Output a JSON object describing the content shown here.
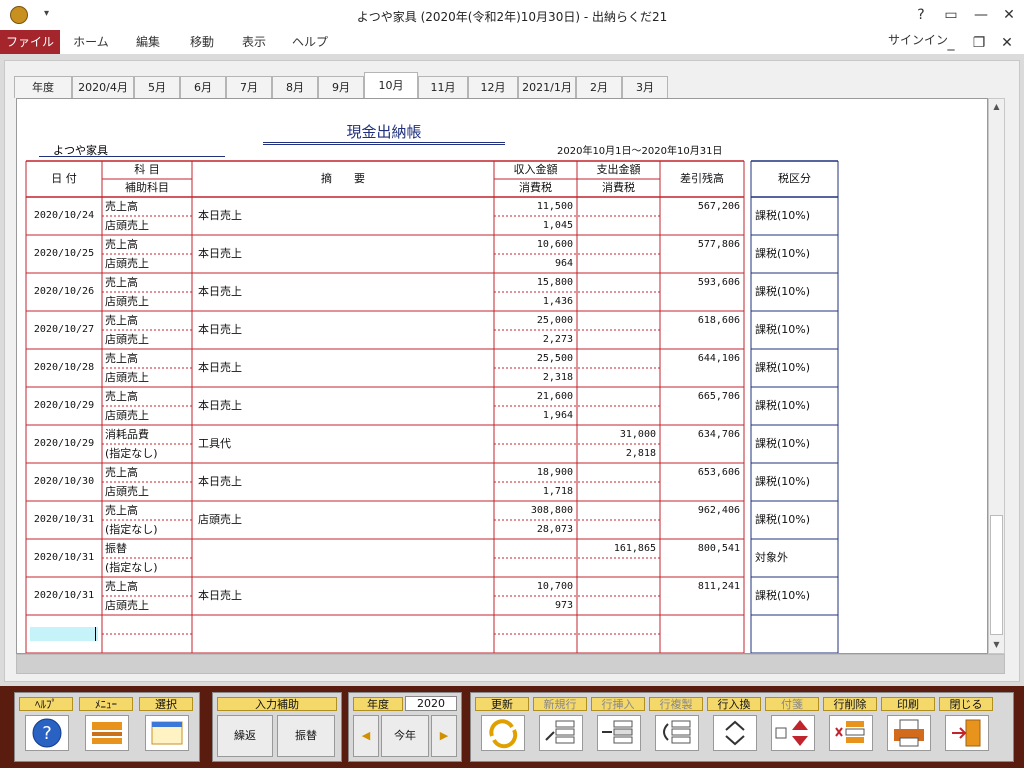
{
  "window": {
    "title": "よつや家具 (2020年(令和2年)10月30日) - 出納らくだ21",
    "qat": "▾",
    "help": "?",
    "restore": "▭",
    "minimize": "—",
    "close": "✕"
  },
  "menu": {
    "file": "ファイル",
    "items": [
      "ホーム",
      "編集",
      "移動",
      "表示",
      "ヘルプ"
    ],
    "signin": "サインイン",
    "min": "_",
    "restore": "❐",
    "close": "✕"
  },
  "tabs": [
    "年度",
    "2020/4月",
    "5月",
    "6月",
    "7月",
    "8月",
    "9月",
    "10月",
    "11月",
    "12月",
    "2021/1月",
    "2月",
    "3月"
  ],
  "active_tab": "10月",
  "ledger": {
    "company": "よつや家具",
    "title": "現金出納帳",
    "period": "2020年10月1日～2020年10月31日",
    "headers": {
      "date": "日 付",
      "account": "科 目",
      "sub_account": "補助科目",
      "summary": "摘　　要",
      "income": "収入金額",
      "income_tax": "消費税",
      "expense": "支出金額",
      "expense_tax": "消費税",
      "balance": "差引残高",
      "tax_class": "税区分"
    },
    "rows": [
      {
        "date": "2020/10/24",
        "account": "売上高",
        "sub": "店頭売上",
        "summary": "本日売上",
        "income": "11,500",
        "income_tax": "1,045",
        "expense": "",
        "expense_tax": "",
        "balance": "567,206",
        "tax": "課税(10%)"
      },
      {
        "date": "2020/10/25",
        "account": "売上高",
        "sub": "店頭売上",
        "summary": "本日売上",
        "income": "10,600",
        "income_tax": "964",
        "expense": "",
        "expense_tax": "",
        "balance": "577,806",
        "tax": "課税(10%)"
      },
      {
        "date": "2020/10/26",
        "account": "売上高",
        "sub": "店頭売上",
        "summary": "本日売上",
        "income": "15,800",
        "income_tax": "1,436",
        "expense": "",
        "expense_tax": "",
        "balance": "593,606",
        "tax": "課税(10%)"
      },
      {
        "date": "2020/10/27",
        "account": "売上高",
        "sub": "店頭売上",
        "summary": "本日売上",
        "income": "25,000",
        "income_tax": "2,273",
        "expense": "",
        "expense_tax": "",
        "balance": "618,606",
        "tax": "課税(10%)"
      },
      {
        "date": "2020/10/28",
        "account": "売上高",
        "sub": "店頭売上",
        "summary": "本日売上",
        "income": "25,500",
        "income_tax": "2,318",
        "expense": "",
        "expense_tax": "",
        "balance": "644,106",
        "tax": "課税(10%)"
      },
      {
        "date": "2020/10/29",
        "account": "売上高",
        "sub": "店頭売上",
        "summary": "本日売上",
        "income": "21,600",
        "income_tax": "1,964",
        "expense": "",
        "expense_tax": "",
        "balance": "665,706",
        "tax": "課税(10%)"
      },
      {
        "date": "2020/10/29",
        "account": "消耗品費",
        "sub": "(指定なし)",
        "summary": "工具代",
        "income": "",
        "income_tax": "",
        "expense": "31,000",
        "expense_tax": "2,818",
        "balance": "634,706",
        "tax": "課税(10%)"
      },
      {
        "date": "2020/10/30",
        "account": "売上高",
        "sub": "店頭売上",
        "summary": "本日売上",
        "income": "18,900",
        "income_tax": "1,718",
        "expense": "",
        "expense_tax": "",
        "balance": "653,606",
        "tax": "課税(10%)"
      },
      {
        "date": "2020/10/31",
        "account": "売上高",
        "sub": "(指定なし)",
        "summary": "店頭売上",
        "income": "308,800",
        "income_tax": "28,073",
        "expense": "",
        "expense_tax": "",
        "balance": "962,406",
        "tax": "課税(10%)"
      },
      {
        "date": "2020/10/31",
        "account": "振替",
        "sub": "(指定なし)",
        "summary": "",
        "income": "",
        "income_tax": "",
        "expense": "161,865",
        "expense_tax": "",
        "balance": "800,541",
        "tax": "対象外"
      },
      {
        "date": "2020/10/31",
        "account": "売上高",
        "sub": "店頭売上",
        "summary": "本日売上",
        "income": "10,700",
        "income_tax": "973",
        "expense": "",
        "expense_tax": "",
        "balance": "811,241",
        "tax": "課税(10%)"
      }
    ]
  },
  "toolbar": {
    "help": "ﾍﾙﾌﾟ",
    "menu": "ﾒﾆｭｰ",
    "select": "選択",
    "input_assist": "入力補助",
    "repeat": "繰返",
    "transfer": "振替",
    "year": "年度",
    "year_value": "2020",
    "this_year": "今年",
    "refresh": "更新",
    "new_row": "新規行",
    "insert_row": "行挿入",
    "copy_row": "行複製",
    "swap_row": "行入換",
    "sticky": "付箋",
    "delete_row": "行削除",
    "print": "印刷",
    "close": "閉じる"
  },
  "colors": {
    "file_menu": "#a4262c",
    "grid_red": "#c0242c",
    "grid_blue": "#21317d",
    "toolbar_bg": "#5a1c0e",
    "label_yellow": "#f4d86a"
  }
}
